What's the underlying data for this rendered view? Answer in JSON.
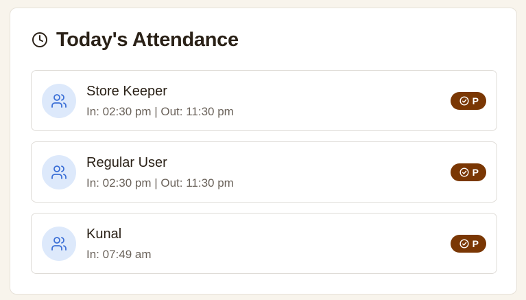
{
  "header": {
    "icon": "clock-icon",
    "title": "Today's Attendance"
  },
  "colors": {
    "accent_badge": "#7a3704",
    "avatar_bg": "#dde9fb",
    "avatar_icon": "#3b6fd6"
  },
  "attendance": [
    {
      "name": "Store Keeper",
      "times": "In: 02:30 pm | Out: 11:30 pm",
      "status": "P",
      "icon": "users-icon",
      "status_icon": "check-circle-icon"
    },
    {
      "name": "Regular User",
      "times": "In: 02:30 pm | Out: 11:30 pm",
      "status": "P",
      "icon": "users-icon",
      "status_icon": "check-circle-icon"
    },
    {
      "name": "Kunal",
      "times": "In: 07:49 am",
      "status": "P",
      "icon": "users-icon",
      "status_icon": "check-circle-icon"
    }
  ]
}
